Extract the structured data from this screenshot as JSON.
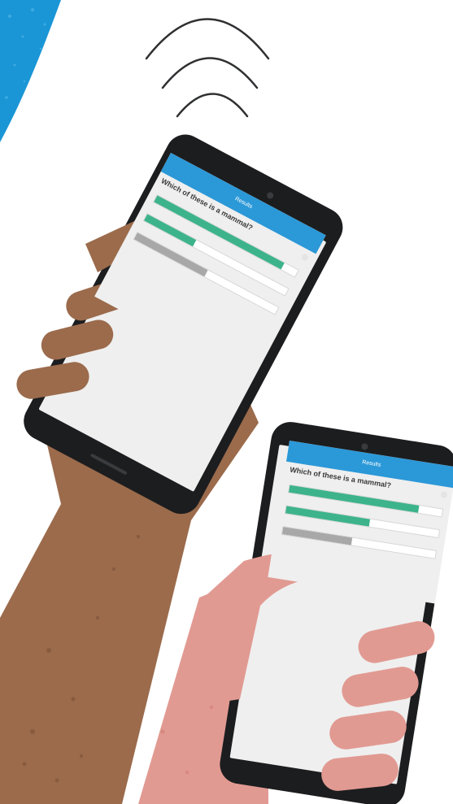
{
  "scene": {
    "background_color": "#ffffff",
    "splash_color": "#1a96d6",
    "waves_color": "#2f3032",
    "phone_body_color": "#1c1d1f",
    "hand_left_color": "#9b6b4c",
    "hand_right_color": "#e19a92"
  },
  "phone_left": {
    "app_bar_color": "#2b98d8",
    "app_bar_title": "Results",
    "question": "Which of these is a mammal?",
    "options": [
      {
        "label": "",
        "fill_fraction": 0.9,
        "color": "#3db38c"
      },
      {
        "label": "",
        "fill_fraction": 0.35,
        "color": "#3db38c"
      },
      {
        "label": "",
        "fill_fraction": 0.5,
        "color": "#a8a8a8"
      }
    ]
  },
  "phone_right": {
    "app_bar_color": "#2b98d8",
    "app_bar_title": "Results",
    "question": "Which of these is a mammal?",
    "options": [
      {
        "label": "",
        "fill_fraction": 0.85,
        "color": "#3db38c"
      },
      {
        "label": "",
        "fill_fraction": 0.55,
        "color": "#3db38c"
      },
      {
        "label": "",
        "fill_fraction": 0.45,
        "color": "#a8a8a8"
      }
    ]
  }
}
